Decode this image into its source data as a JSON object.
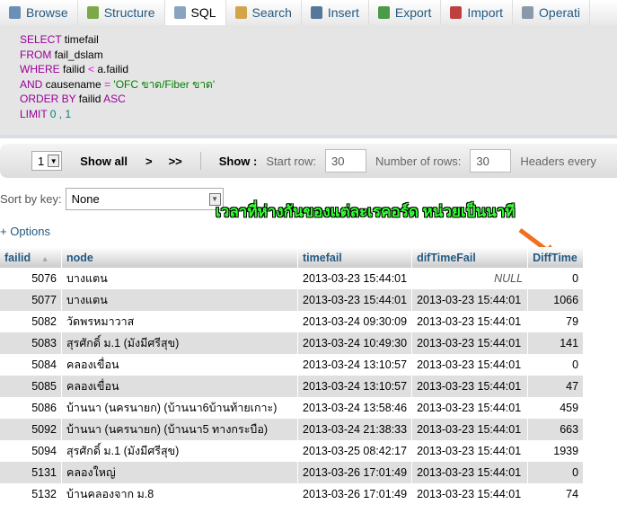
{
  "tabs": [
    {
      "label": "Browse",
      "icon": "browse-icon",
      "color": "#6b8fb5"
    },
    {
      "label": "Structure",
      "icon": "structure-icon",
      "color": "#7da84a"
    },
    {
      "label": "SQL",
      "icon": "sql-icon",
      "color": "#8aa4c0",
      "active": true
    },
    {
      "label": "Search",
      "icon": "search-icon",
      "color": "#d4a44a"
    },
    {
      "label": "Insert",
      "icon": "insert-icon",
      "color": "#557799"
    },
    {
      "label": "Export",
      "icon": "export-icon",
      "color": "#4a9a4a"
    },
    {
      "label": "Import",
      "icon": "import-icon",
      "color": "#c04040"
    },
    {
      "label": "Operati",
      "icon": "wrench-icon",
      "color": "#8899aa"
    }
  ],
  "sql": {
    "select": "SELECT",
    "select_rest": " timefail",
    "from": "FROM",
    "from_rest": " fail_dslam",
    "where": "WHERE",
    "where_rest": " failid ",
    "lt": "<",
    "where_rest2": " a.failid",
    "and": "AND",
    "and_rest": " causename ",
    "eq": "=",
    "str": " 'OFC ขาด/Fiber ขาด'",
    "order": "ORDER BY",
    "order_rest": " failid ",
    "asc": "ASC",
    "limit": "LIMIT",
    "limit_rest": " 0 , 1"
  },
  "nav": {
    "page": "1",
    "show_all": "Show all",
    "next": ">",
    "last": ">>",
    "show": "Show :",
    "start_row_label": "Start row:",
    "start_row": "30",
    "num_rows_label": "Number of rows:",
    "num_rows": "30",
    "headers_every": "Headers every"
  },
  "sort": {
    "label": "Sort by key:",
    "value": "None"
  },
  "options": "+ Options",
  "annotation": "เวลาที่ห่างกันของแต่ละเรคอร์ด หน่วยเป็นนาที",
  "table": {
    "headers": [
      "failid",
      "node",
      "timefail",
      "difTimeFail",
      "DiffTime"
    ],
    "rows": [
      [
        "5076",
        "บางแตน",
        "2013-03-23 15:44:01",
        "NULL",
        "0"
      ],
      [
        "5077",
        "บางแตน",
        "2013-03-23 15:44:01",
        "2013-03-23 15:44:01",
        "1066"
      ],
      [
        "5082",
        "วัดพรหมาวาส",
        "2013-03-24 09:30:09",
        "2013-03-23 15:44:01",
        "79"
      ],
      [
        "5083",
        "สุรศักดิ์ ม.1 (มังมีศรีสุข)",
        "2013-03-24 10:49:30",
        "2013-03-23 15:44:01",
        "141"
      ],
      [
        "5084",
        "คลองเขื่อน",
        "2013-03-24 13:10:57",
        "2013-03-23 15:44:01",
        "0"
      ],
      [
        "5085",
        "คลองเขื่อน",
        "2013-03-24 13:10:57",
        "2013-03-23 15:44:01",
        "47"
      ],
      [
        "5086",
        "บ้านนา (นครนายก) (บ้านนา6บ้านท้ายเกาะ)",
        "2013-03-24 13:58:46",
        "2013-03-23 15:44:01",
        "459"
      ],
      [
        "5092",
        "บ้านนา (นครนายก) (บ้านนา5 ทางกระบือ)",
        "2013-03-24 21:38:33",
        "2013-03-23 15:44:01",
        "663"
      ],
      [
        "5094",
        "สุรศักดิ์ ม.1 (มังมีศรีสุข)",
        "2013-03-25 08:42:17",
        "2013-03-23 15:44:01",
        "1939"
      ],
      [
        "5131",
        "คลองใหญ่",
        "2013-03-26 17:01:49",
        "2013-03-23 15:44:01",
        "0"
      ],
      [
        "5132",
        "บ้านคลองจาก ม.8",
        "2013-03-26 17:01:49",
        "2013-03-23 15:44:01",
        "74"
      ]
    ]
  }
}
